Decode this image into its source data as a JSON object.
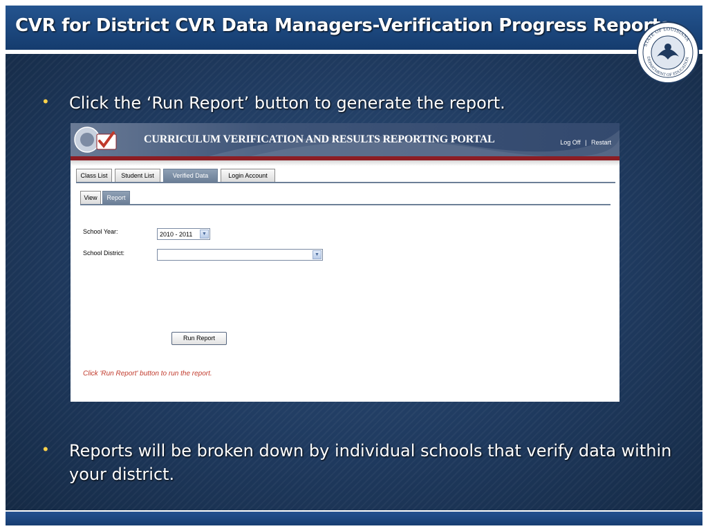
{
  "slide": {
    "title": "CVR for District CVR Data Managers-Verification Progress Reports",
    "bullet_1": "Click the ‘Run Report’ button to generate the report.",
    "bullet_2": "Reports will be broken down by individual schools that verify data within your district.",
    "seal_text": "STATE OF LOUISIANA · DEPARTMENT OF EDUCATION"
  },
  "portal": {
    "title": "CURRICULUM VERIFICATION AND RESULTS REPORTING PORTAL",
    "log_off": "Log Off",
    "separator": "|",
    "restart": "Restart",
    "tabs": [
      "Class List",
      "Student List",
      "Verified Data",
      "Login Account"
    ],
    "active_tab": "Verified Data",
    "subtabs": [
      "View",
      "Report"
    ],
    "active_subtab": "Report",
    "form": {
      "school_year_label": "School Year:",
      "school_year_value": "2010 - 2011",
      "school_district_label": "School District:",
      "school_district_value": ""
    },
    "run_report_label": "Run Report",
    "message": "Click 'Run Report' button to run the report."
  },
  "colors": {
    "title_bar": "#1f4a82",
    "background": "#1f3a5f",
    "bullet": "#ffd24a",
    "tab_active": "#7a8ba3",
    "message": "#c0392b"
  }
}
